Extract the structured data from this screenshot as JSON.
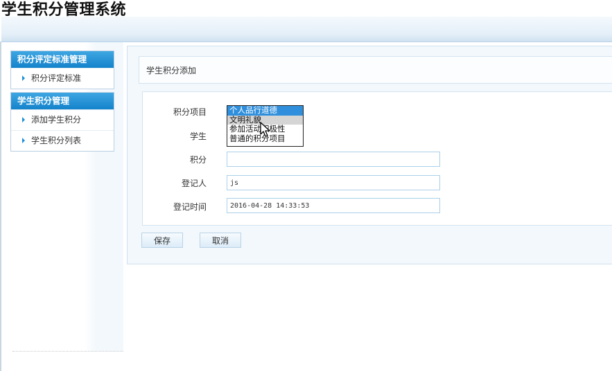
{
  "app": {
    "title": "学生积分管理系统"
  },
  "sidebar": {
    "groups": [
      {
        "header": "积分评定标准管理",
        "items": [
          {
            "label": "积分评定标准"
          }
        ]
      },
      {
        "header": "学生积分管理",
        "items": [
          {
            "label": "添加学生积分"
          },
          {
            "label": "学生积分列表"
          }
        ]
      }
    ]
  },
  "main": {
    "section_title": "学生积分添加",
    "form": {
      "item_label": "积分项目",
      "item_options": [
        "个人品行道德",
        "文明礼貌",
        "参加活动积极性",
        "普通的积分项目"
      ],
      "item_selected": "个人品行道德",
      "item_hovered": "文明礼貌",
      "student_label": "学生",
      "score_label": "积分",
      "score_value": "",
      "recorder_label": "登记人",
      "recorder_value": "js",
      "time_label": "登记时间",
      "time_value": "2016-04-28 14:33:53"
    },
    "buttons": {
      "save": "保存",
      "cancel": "取消"
    }
  },
  "colors": {
    "menu_header": "#1483cb",
    "option_selected": "#2f8fdc",
    "input_border": "#a9cfe8"
  }
}
